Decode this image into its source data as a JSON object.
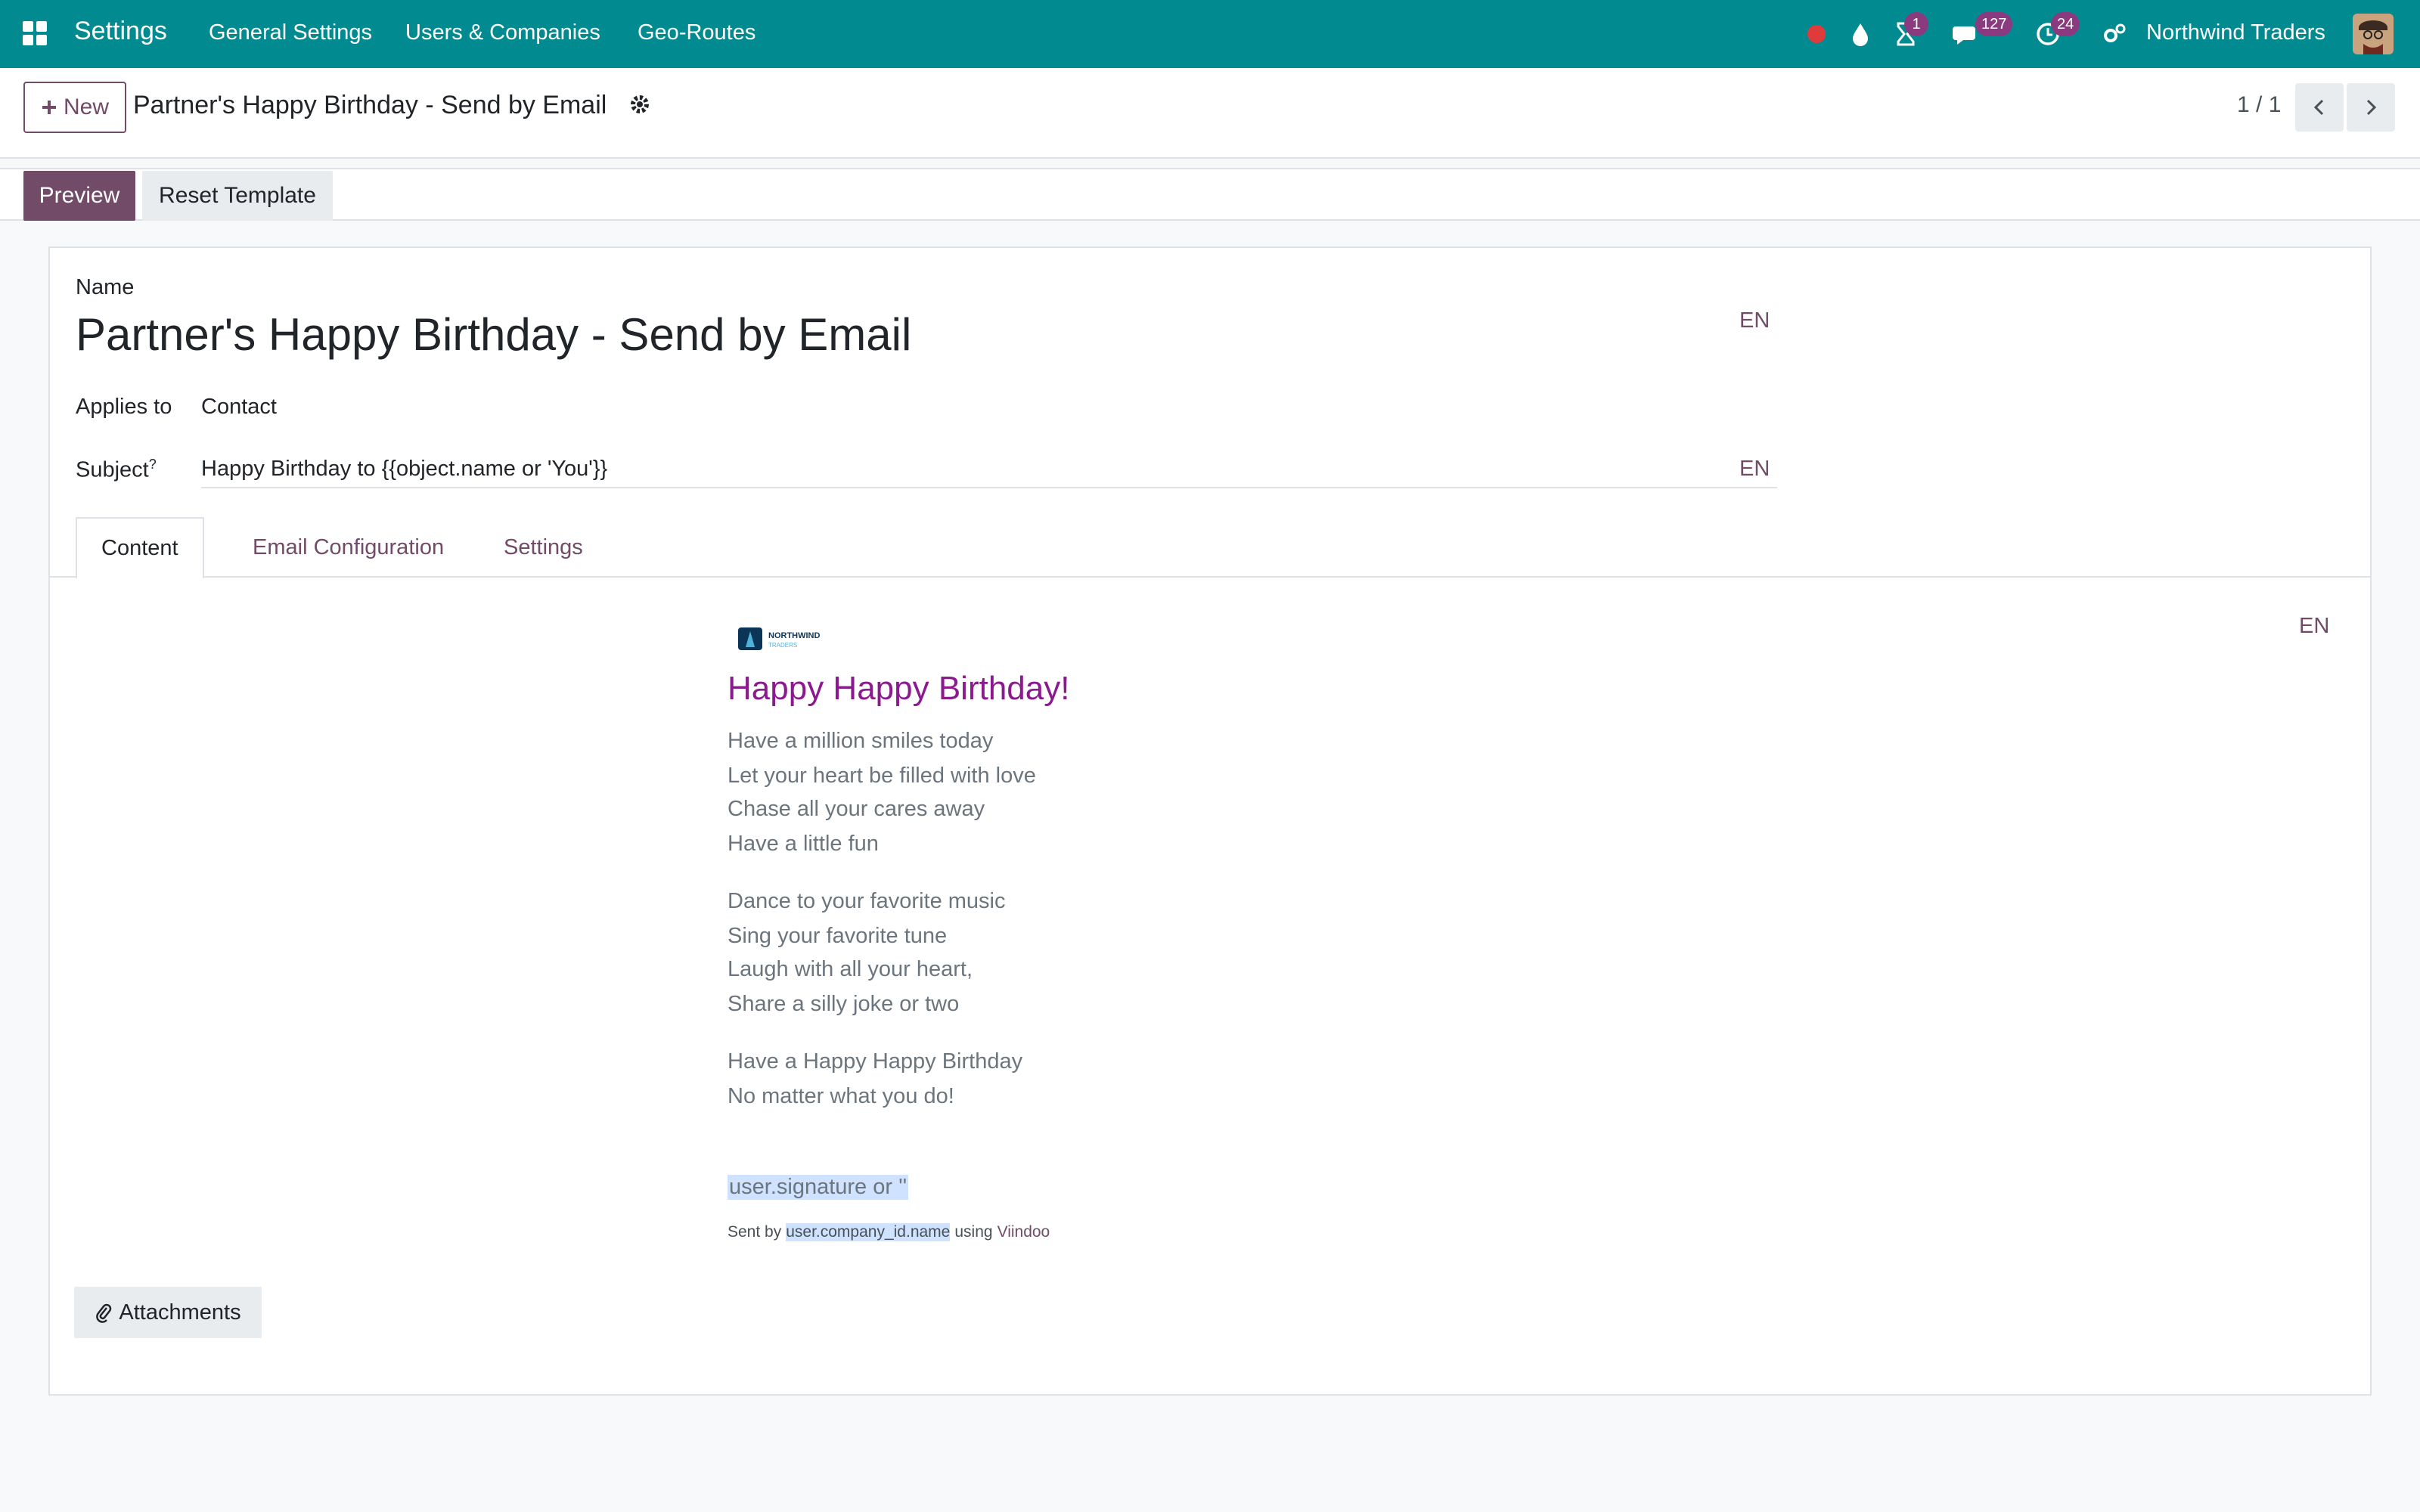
{
  "navbar": {
    "brand": "Settings",
    "menu": [
      "General Settings",
      "Users & Companies",
      "Geo-Routes"
    ],
    "badges": {
      "activity": "1",
      "messages": "127",
      "todo": "24"
    },
    "company": "Northwind Traders",
    "accent": "#018b91"
  },
  "control": {
    "new_label": "New",
    "title": "Partner's Happy Birthday - Send by Email",
    "pager": "1 / 1"
  },
  "status": {
    "preview_label": "Preview",
    "reset_label": "Reset Template"
  },
  "form": {
    "name_label": "Name",
    "name_value": "Partner's Happy Birthday - Send by Email",
    "lang": "EN",
    "applies_label": "Applies to",
    "applies_value": "Contact",
    "subject_label": "Subject",
    "subject_help": "?",
    "subject_value": "Happy Birthday to {{object.name or 'You'}}",
    "tabs": [
      "Content",
      "Email Configuration",
      "Settings"
    ]
  },
  "email": {
    "logo_text": "NORTHWIND",
    "logo_sub": "TRADERS",
    "headline": "Happy Happy Birthday!",
    "lines": [
      "Have a million smiles today",
      "Let your heart be filled with love",
      "Chase all your cares away",
      "Have a little fun",
      "Dance to your favorite music",
      "Sing your favorite tune",
      "Laugh with all your heart,",
      "Share a silly joke or two",
      "Have a Happy Happy Birthday",
      "No matter what you do!"
    ],
    "signature": "user.signature or ''",
    "sent_by": "Sent by",
    "company_placeholder": "user.company_id.name",
    "using": "using",
    "app_link": "Viindoo"
  },
  "attachments_label": "Attachments"
}
